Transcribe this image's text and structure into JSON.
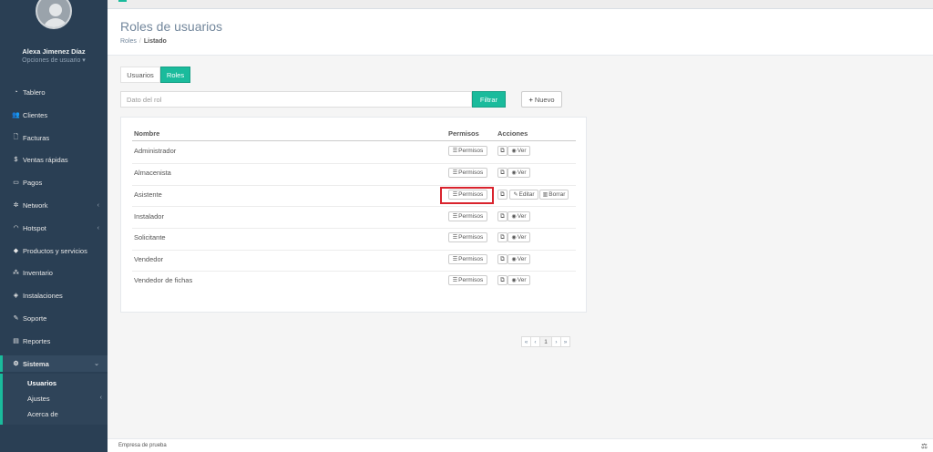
{
  "user": {
    "name": "Alexa Jimenez Díaz",
    "options": "Opciones de usuario ▾"
  },
  "sidebar": {
    "items": [
      {
        "icon": "tachometer-icon",
        "glyph": "◔",
        "label": "Tablero"
      },
      {
        "icon": "users-icon",
        "glyph": "👥",
        "label": "Clientes"
      },
      {
        "icon": "file-icon",
        "glyph": "🗋",
        "label": "Facturas"
      },
      {
        "icon": "dollar-icon",
        "glyph": "$",
        "label": "Ventas rápidas"
      },
      {
        "icon": "money-icon",
        "glyph": "▭",
        "label": "Pagos"
      },
      {
        "icon": "sitemap-icon",
        "glyph": "✲",
        "label": "Network"
      },
      {
        "icon": "wifi-icon",
        "glyph": "◠",
        "label": "Hotspot"
      },
      {
        "icon": "tags-icon",
        "glyph": "◆",
        "label": "Productos y servicios"
      },
      {
        "icon": "cubes-icon",
        "glyph": "⁂",
        "label": "Inventario"
      },
      {
        "icon": "wrench-icon",
        "glyph": "◈",
        "label": "Instalaciones"
      },
      {
        "icon": "tools-icon",
        "glyph": "✎",
        "label": "Soporte"
      },
      {
        "icon": "book-icon",
        "glyph": "▤",
        "label": "Reportes"
      },
      {
        "icon": "cogs-icon",
        "glyph": "⚙",
        "label": "Sistema"
      }
    ],
    "sistema_sub": [
      {
        "label": "Usuarios"
      },
      {
        "label": "Ajustes"
      },
      {
        "label": "Acerca de"
      }
    ]
  },
  "header": {
    "title": "Roles de usuarios",
    "breadcrumb": {
      "root": "Roles",
      "separator": "/",
      "current": "Listado"
    }
  },
  "tabs": {
    "usuarios": "Usuarios",
    "roles": "Roles"
  },
  "filter": {
    "placeholder": "Dato del rol",
    "button": "Filtrar",
    "new_button": "Nuevo",
    "new_icon": "+"
  },
  "table": {
    "headers": {
      "name": "Nombre",
      "permissions": "Permisos",
      "actions": "Acciones"
    },
    "permissions_label": "Permisos",
    "view_label": "Ver",
    "edit_label": "Editar",
    "delete_label": "Borrar",
    "rows": [
      {
        "name": "Administrador"
      },
      {
        "name": "Almacenista"
      },
      {
        "name": "Asistente"
      },
      {
        "name": "Instalador"
      },
      {
        "name": "Solicitante"
      },
      {
        "name": "Vendedor"
      },
      {
        "name": "Vendedor de fichas"
      }
    ]
  },
  "pagination": {
    "first": "«",
    "prev": "‹",
    "page": "1",
    "next": "›",
    "last": "»"
  },
  "footer": {
    "text": "Empresa de prueba"
  },
  "colors": {
    "accent": "#1abb9c",
    "sidebar": "#2a3f54",
    "highlight": "#d9232d"
  }
}
